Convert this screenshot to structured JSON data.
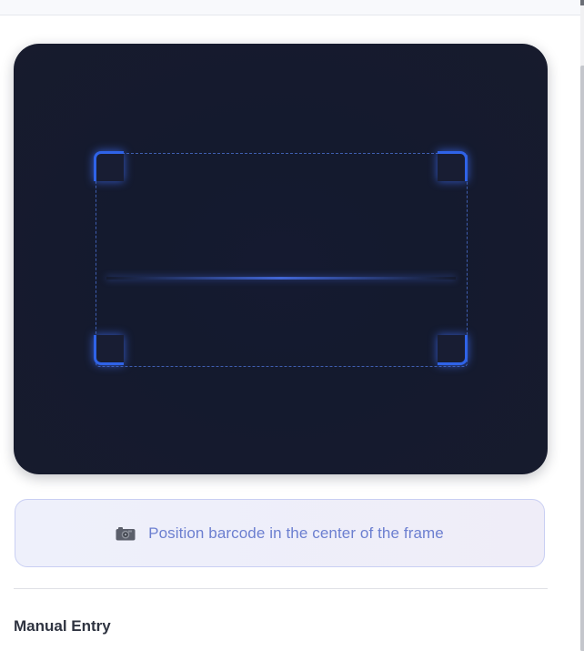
{
  "scanner": {
    "hint_icon": "camera-icon",
    "hint_text": "Position barcode in the center of the frame"
  },
  "manual_entry": {
    "title": "Manual Entry"
  },
  "colors": {
    "accent": "#2f63e8",
    "scanner_bg": "#141a2e",
    "hint_text": "#6c7fd0",
    "hint_border": "#c9cff3"
  }
}
